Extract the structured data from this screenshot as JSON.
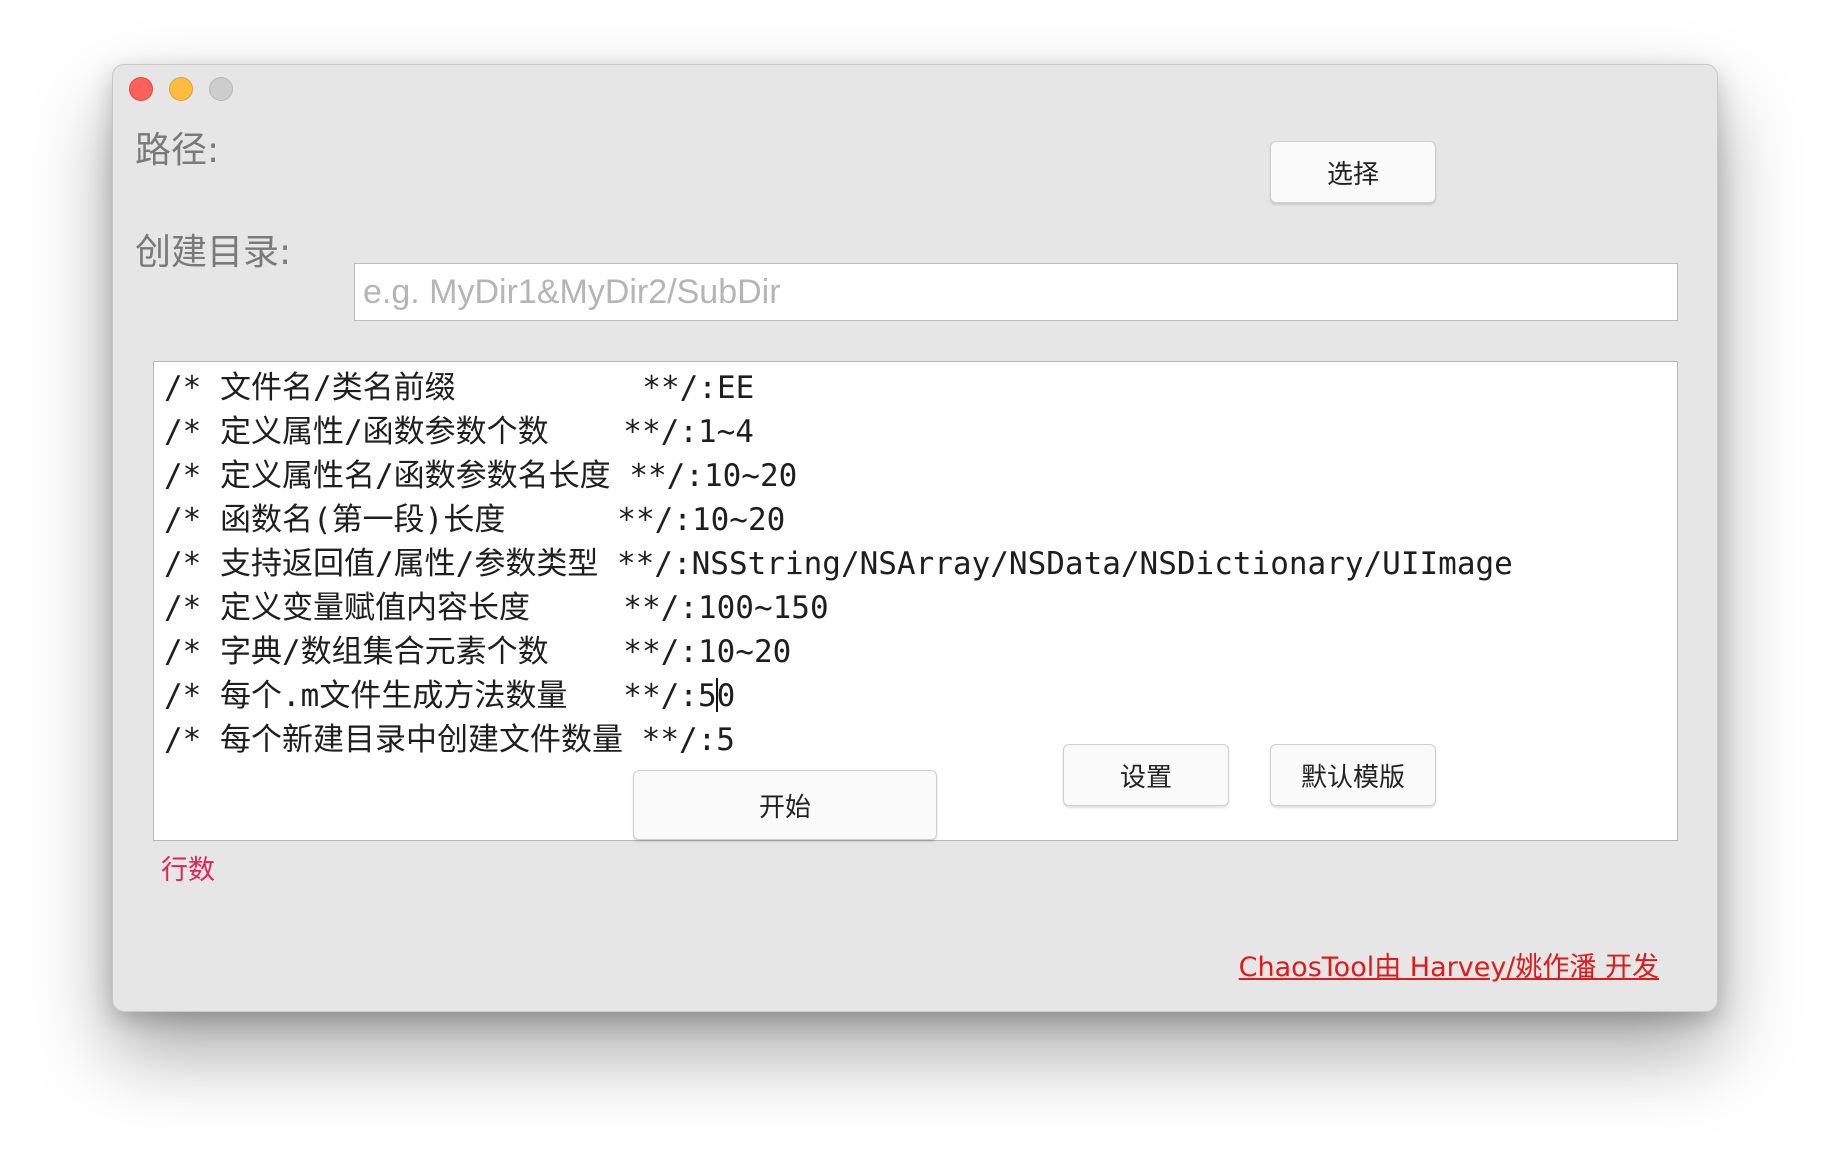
{
  "window": {
    "controls": {
      "close": "close-icon",
      "minimize": "minimize-icon",
      "zoom": "zoom-icon"
    }
  },
  "path": {
    "label": "路径:",
    "choose_button": "选择"
  },
  "create_dir": {
    "label": "创建目录:",
    "value": "",
    "placeholder": "e.g. MyDir1&MyDir2/SubDir"
  },
  "config_lines": [
    "/* 文件名/类名前缀          **/:EE",
    "/* 定义属性/函数参数个数    **/:1~4",
    "/* 定义属性名/函数参数名长度 **/:10~20",
    "/* 函数名(第一段)长度      **/:10~20",
    "/* 支持返回值/属性/参数类型 **/:NSString/NSArray/NSData/NSDictionary/UIImage",
    "/* 定义变量赋值内容长度     **/:100~150",
    "/* 字典/数组集合元素个数    **/:10~20",
    "/* 每个.m文件生成方法数量   **/:5",
    "0",
    "/* 每个新建目录中创建文件数量 **/:5"
  ],
  "footer": {
    "row_count_label": "行数",
    "start_button": "开始",
    "settings_button": "设置",
    "default_template_button": "默认模版",
    "credit_link": "ChaosTool由 Harvey/姚作潘 开发"
  },
  "colors": {
    "window_bg": "#e6e6e6",
    "label": "#7a7a7a",
    "row_count": "#e0235a",
    "credit": "#e01a1a"
  }
}
